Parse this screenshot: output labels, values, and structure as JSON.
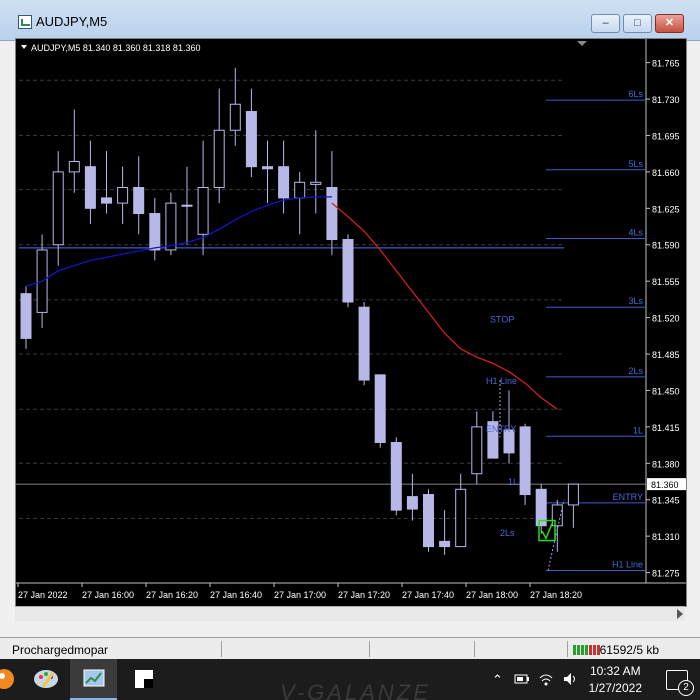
{
  "window": {
    "title": "AUDJPY,M5"
  },
  "chart_header": {
    "symbol": "AUDJPY,M5",
    "ohlc": "81.340 81.360 81.318 81.360"
  },
  "colors": {
    "bg": "#000000",
    "candle_fill": "#b8b8e8",
    "grid": "#3a3a3a",
    "level": "#3c5cc8",
    "ma_blue": "#1414c8",
    "ma_red": "#d21e1e",
    "current_price": "#aaaaaa"
  },
  "chart_data": {
    "type": "candlestick",
    "ylim": [
      81.265,
      81.78
    ],
    "y_ticks": [
      "81.765",
      "81.730",
      "81.695",
      "81.660",
      "81.625",
      "81.590",
      "81.555",
      "81.520",
      "81.485",
      "81.450",
      "81.415",
      "81.380",
      "81.345",
      "81.310",
      "81.275"
    ],
    "x_ticks": [
      "27 Jan 2022",
      "27 Jan 16:00",
      "27 Jan 16:20",
      "27 Jan 16:40",
      "27 Jan 17:00",
      "27 Jan 17:20",
      "27 Jan 17:40",
      "27 Jan 18:00",
      "27 Jan 18:20"
    ],
    "current_price": "81.360",
    "candles": [
      {
        "o": 81.543,
        "h": 81.55,
        "c": 81.5,
        "l": 81.49
      },
      {
        "o": 81.525,
        "h": 81.6,
        "c": 81.585,
        "l": 81.51
      },
      {
        "o": 81.59,
        "h": 81.68,
        "c": 81.66,
        "l": 81.57
      },
      {
        "o": 81.66,
        "h": 81.72,
        "c": 81.67,
        "l": 81.64
      },
      {
        "o": 81.665,
        "h": 81.69,
        "c": 81.625,
        "l": 81.61
      },
      {
        "o": 81.635,
        "h": 81.68,
        "c": 81.63,
        "l": 81.62
      },
      {
        "o": 81.63,
        "h": 81.665,
        "c": 81.645,
        "l": 81.61
      },
      {
        "o": 81.645,
        "h": 81.675,
        "c": 81.62,
        "l": 81.6
      },
      {
        "o": 81.62,
        "h": 81.635,
        "c": 81.585,
        "l": 81.575
      },
      {
        "o": 81.585,
        "h": 81.64,
        "c": 81.63,
        "l": 81.58
      },
      {
        "o": 81.628,
        "h": 81.665,
        "c": 81.627,
        "l": 81.59
      },
      {
        "o": 81.6,
        "h": 81.69,
        "c": 81.645,
        "l": 81.58
      },
      {
        "o": 81.645,
        "h": 81.74,
        "c": 81.7,
        "l": 81.63
      },
      {
        "o": 81.7,
        "h": 81.76,
        "c": 81.725,
        "l": 81.685
      },
      {
        "o": 81.718,
        "h": 81.74,
        "c": 81.665,
        "l": 81.655
      },
      {
        "o": 81.665,
        "h": 81.69,
        "c": 81.663,
        "l": 81.63
      },
      {
        "o": 81.665,
        "h": 81.69,
        "c": 81.635,
        "l": 81.62
      },
      {
        "o": 81.635,
        "h": 81.66,
        "c": 81.65,
        "l": 81.6
      },
      {
        "o": 81.648,
        "h": 81.7,
        "c": 81.65,
        "l": 81.62
      },
      {
        "o": 81.645,
        "h": 81.68,
        "c": 81.595,
        "l": 81.58
      },
      {
        "o": 81.595,
        "h": 81.6,
        "c": 81.535,
        "l": 81.53
      },
      {
        "o": 81.53,
        "h": 81.535,
        "c": 81.46,
        "l": 81.455
      },
      {
        "o": 81.465,
        "h": 81.465,
        "c": 81.4,
        "l": 81.395
      },
      {
        "o": 81.4,
        "h": 81.405,
        "c": 81.335,
        "l": 81.33
      },
      {
        "o": 81.348,
        "h": 81.37,
        "c": 81.336,
        "l": 81.325
      },
      {
        "o": 81.35,
        "h": 81.355,
        "c": 81.3,
        "l": 81.295
      },
      {
        "o": 81.305,
        "h": 81.335,
        "c": 81.3,
        "l": 81.292
      },
      {
        "o": 81.3,
        "h": 81.37,
        "c": 81.355,
        "l": 81.3
      },
      {
        "o": 81.37,
        "h": 81.43,
        "c": 81.415,
        "l": 81.36
      },
      {
        "o": 81.42,
        "h": 81.43,
        "c": 81.385,
        "l": 81.385
      },
      {
        "o": 81.412,
        "h": 81.45,
        "c": 81.39,
        "l": 81.38
      },
      {
        "o": 81.415,
        "h": 81.418,
        "c": 81.35,
        "l": 81.34
      },
      {
        "o": 81.355,
        "h": 81.36,
        "c": 81.32,
        "l": 81.312
      },
      {
        "o": 81.32,
        "h": 81.345,
        "c": 81.34,
        "l": 81.295
      },
      {
        "o": 81.34,
        "h": 81.36,
        "c": 81.36,
        "l": 81.318
      }
    ],
    "ma_blue": [
      81.55,
      81.555,
      81.565,
      81.57,
      81.575,
      81.578,
      81.581,
      81.584,
      81.587,
      81.589,
      81.592,
      81.597,
      81.605,
      81.614,
      81.622,
      81.628,
      81.633,
      81.635,
      81.636,
      81.636
    ],
    "ma_red": [
      81.63,
      81.617,
      81.603,
      81.585,
      81.565,
      81.545,
      81.525,
      81.505,
      81.49,
      81.482,
      81.476,
      81.468,
      81.457,
      81.443,
      81.432
    ],
    "blue_horizontal": 81.587,
    "grid_levels": [
      81.748,
      81.695,
      81.643,
      81.59,
      81.537,
      81.485,
      81.432,
      81.38,
      81.327
    ],
    "right_levels": [
      {
        "label": "6Ls",
        "price": 81.729
      },
      {
        "label": "5Ls",
        "price": 81.662
      },
      {
        "label": "4Ls",
        "price": 81.596
      },
      {
        "label": "3Ls",
        "price": 81.53
      },
      {
        "label": "2Ls",
        "price": 81.463
      },
      {
        "label": "1L",
        "price": 81.406
      },
      {
        "label": "ENTRY",
        "price": 81.342
      },
      {
        "label": "H1 Line",
        "price": 81.277
      }
    ],
    "annotations": [
      {
        "text": "STOP",
        "price": 81.519
      },
      {
        "text": "H1 Line",
        "price": 81.46
      },
      {
        "text": "ENTRY",
        "price": 81.414
      },
      {
        "text": "1L",
        "price": 81.363
      },
      {
        "text": "2Ls",
        "price": 81.314
      }
    ]
  },
  "statusbar": {
    "user": "Prochargedmopar",
    "traffic": "61592/5 kb"
  },
  "taskbar": {
    "time": "10:32 AM",
    "date": "1/27/2022",
    "notifications": "2",
    "watermark": "V-GALANZE"
  }
}
